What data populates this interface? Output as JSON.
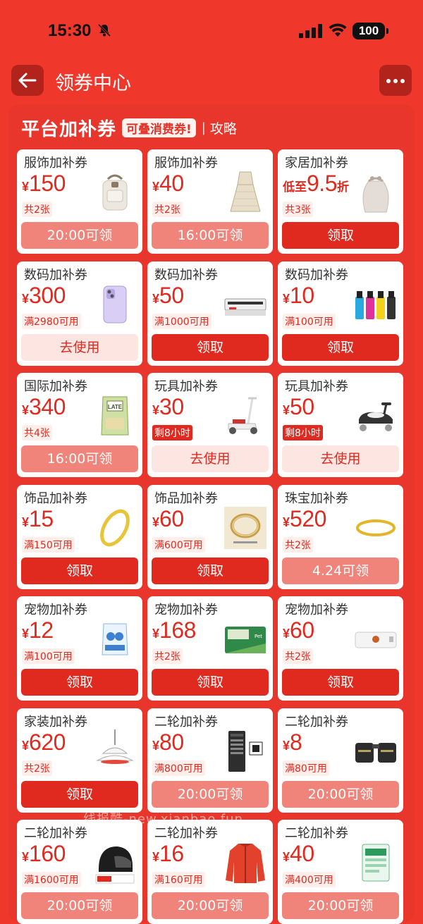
{
  "status": {
    "time": "15:30",
    "battery": "100"
  },
  "nav": {
    "title": "领券中心"
  },
  "panel": {
    "title": "平台加补券",
    "tag": "可叠消费券!",
    "separator": "|",
    "guide": "攻略"
  },
  "cards": [
    {
      "category": "服饰加补券",
      "prefix": "",
      "yen": "¥",
      "amount": "150",
      "suffix": "",
      "condition": "共2张",
      "button": "20:00可领",
      "btn_style": "pink",
      "icon": "backpack-icon"
    },
    {
      "category": "服饰加补券",
      "prefix": "",
      "yen": "¥",
      "amount": "40",
      "suffix": "",
      "condition": "共2张",
      "button": "16:00可领",
      "btn_style": "pink",
      "icon": "dress-icon"
    },
    {
      "category": "家居加补券",
      "prefix": "低至",
      "yen": "",
      "amount": "9.5",
      "suffix": "折",
      "condition": "共3张",
      "button": "领取",
      "btn_style": "red",
      "icon": "bag-icon"
    },
    {
      "category": "数码加补券",
      "prefix": "",
      "yen": "¥",
      "amount": "300",
      "suffix": "",
      "condition": "满2980可用",
      "button": "去使用",
      "btn_style": "light",
      "icon": "phone-icon"
    },
    {
      "category": "数码加补券",
      "prefix": "",
      "yen": "¥",
      "amount": "50",
      "suffix": "",
      "condition": "满1000可用",
      "button": "领取",
      "btn_style": "red",
      "icon": "printer-icon"
    },
    {
      "category": "数码加补券",
      "prefix": "",
      "yen": "¥",
      "amount": "10",
      "suffix": "",
      "condition": "满100可用",
      "button": "领取",
      "btn_style": "red",
      "icon": "ink-bottles-icon"
    },
    {
      "category": "国际加补券",
      "prefix": "",
      "yen": "¥",
      "amount": "340",
      "suffix": "",
      "condition": "共4张",
      "button": "16:00可领",
      "btn_style": "pink",
      "icon": "snack-bag-icon"
    },
    {
      "category": "玩具加补券",
      "prefix": "",
      "yen": "¥",
      "amount": "30",
      "suffix": "",
      "condition": "剩8小时",
      "button": "去使用",
      "btn_style": "light",
      "icon": "scooter-icon",
      "cond_strong": true
    },
    {
      "category": "玩具加补券",
      "prefix": "",
      "yen": "¥",
      "amount": "50",
      "suffix": "",
      "condition": "剩8小时",
      "button": "去使用",
      "btn_style": "light",
      "icon": "ride-on-car-icon",
      "cond_strong": true
    },
    {
      "category": "饰品加补券",
      "prefix": "",
      "yen": "¥",
      "amount": "15",
      "suffix": "",
      "condition": "满150可用",
      "button": "领取",
      "btn_style": "red",
      "icon": "bangle-icon"
    },
    {
      "category": "饰品加补券",
      "prefix": "",
      "yen": "¥",
      "amount": "60",
      "suffix": "",
      "condition": "满600可用",
      "button": "领取",
      "btn_style": "red",
      "icon": "bracelet-icon"
    },
    {
      "category": "珠宝加补券",
      "prefix": "",
      "yen": "¥",
      "amount": "520",
      "suffix": "",
      "condition": "共2张",
      "button": "4.24可领",
      "btn_style": "pink",
      "icon": "gold-ring-icon"
    },
    {
      "category": "宠物加补券",
      "prefix": "",
      "yen": "¥",
      "amount": "12",
      "suffix": "",
      "condition": "满100可用",
      "button": "领取",
      "btn_style": "red",
      "icon": "pet-food-bag-icon"
    },
    {
      "category": "宠物加补券",
      "prefix": "",
      "yen": "¥",
      "amount": "168",
      "suffix": "",
      "condition": "共2张",
      "button": "领取",
      "btn_style": "red",
      "icon": "pet-food-box-icon"
    },
    {
      "category": "宠物加补券",
      "prefix": "",
      "yen": "¥",
      "amount": "60",
      "suffix": "",
      "condition": "共2张",
      "button": "领取",
      "btn_style": "red",
      "icon": "pet-device-icon"
    },
    {
      "category": "家装加补券",
      "prefix": "",
      "yen": "¥",
      "amount": "620",
      "suffix": "",
      "condition": "共2张",
      "button": "领取",
      "btn_style": "red",
      "icon": "pendant-lamp-icon"
    },
    {
      "category": "二轮加补券",
      "prefix": "",
      "yen": "¥",
      "amount": "80",
      "suffix": "",
      "condition": "满800可用",
      "button": "20:00可领",
      "btn_style": "pink",
      "icon": "charging-station-icon"
    },
    {
      "category": "二轮加补券",
      "prefix": "",
      "yen": "¥",
      "amount": "8",
      "suffix": "",
      "condition": "满80可用",
      "button": "20:00可领",
      "btn_style": "pink",
      "icon": "saddle-bag-icon"
    },
    {
      "category": "二轮加补券",
      "prefix": "",
      "yen": "¥",
      "amount": "160",
      "suffix": "",
      "condition": "满1600可用",
      "button": "20:00可领",
      "btn_style": "pink",
      "icon": "helmet-icon"
    },
    {
      "category": "二轮加补券",
      "prefix": "",
      "yen": "¥",
      "amount": "16",
      "suffix": "",
      "condition": "满160可用",
      "button": "20:00可领",
      "btn_style": "pink",
      "icon": "jacket-icon"
    },
    {
      "category": "二轮加补券",
      "prefix": "",
      "yen": "¥",
      "amount": "40",
      "suffix": "",
      "condition": "满400可用",
      "button": "20:00可领",
      "btn_style": "pink",
      "icon": "battery-box-icon"
    }
  ],
  "watermark": "线报酷-new.xianbao.fun",
  "colors": {
    "background": "#f0372c",
    "accent": "#e02a20",
    "button_pink": "#f0837a",
    "button_light": "#fde5e1"
  }
}
